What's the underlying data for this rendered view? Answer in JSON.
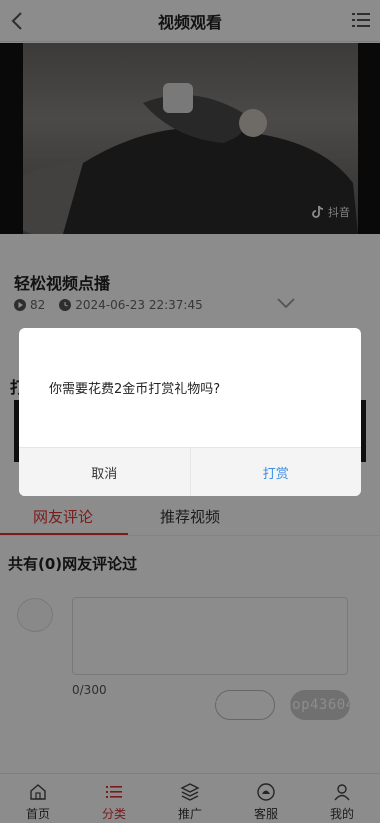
{
  "header": {
    "title": "视频观看"
  },
  "video": {
    "watermark": "抖音"
  },
  "info": {
    "title": "轻松视频点播",
    "views": "82",
    "datetime": "2024-06-23 22:37:45"
  },
  "gift": {
    "heading": "打"
  },
  "tabs": [
    {
      "label": "网友评论",
      "active": true
    },
    {
      "label": "推荐视频",
      "active": false
    }
  ],
  "comments": {
    "heading": "共有(0)网友评论过",
    "counter": "0/300"
  },
  "watermark_url": "https://www.huzhan.com/ishop43604",
  "dialog": {
    "message": "你需要花费2金币打赏礼物吗?",
    "cancel_label": "取消",
    "confirm_label": "打赏"
  },
  "nav": {
    "items": [
      {
        "label": "首页",
        "icon": "home-icon",
        "active": false
      },
      {
        "label": "分类",
        "icon": "list-icon",
        "active": true
      },
      {
        "label": "推广",
        "icon": "layers-icon",
        "active": false
      },
      {
        "label": "客服",
        "icon": "support-icon",
        "active": false
      },
      {
        "label": "我的",
        "icon": "user-icon",
        "active": false
      }
    ]
  },
  "colors": {
    "accent": "#d33333",
    "link": "#3a8ee6"
  }
}
